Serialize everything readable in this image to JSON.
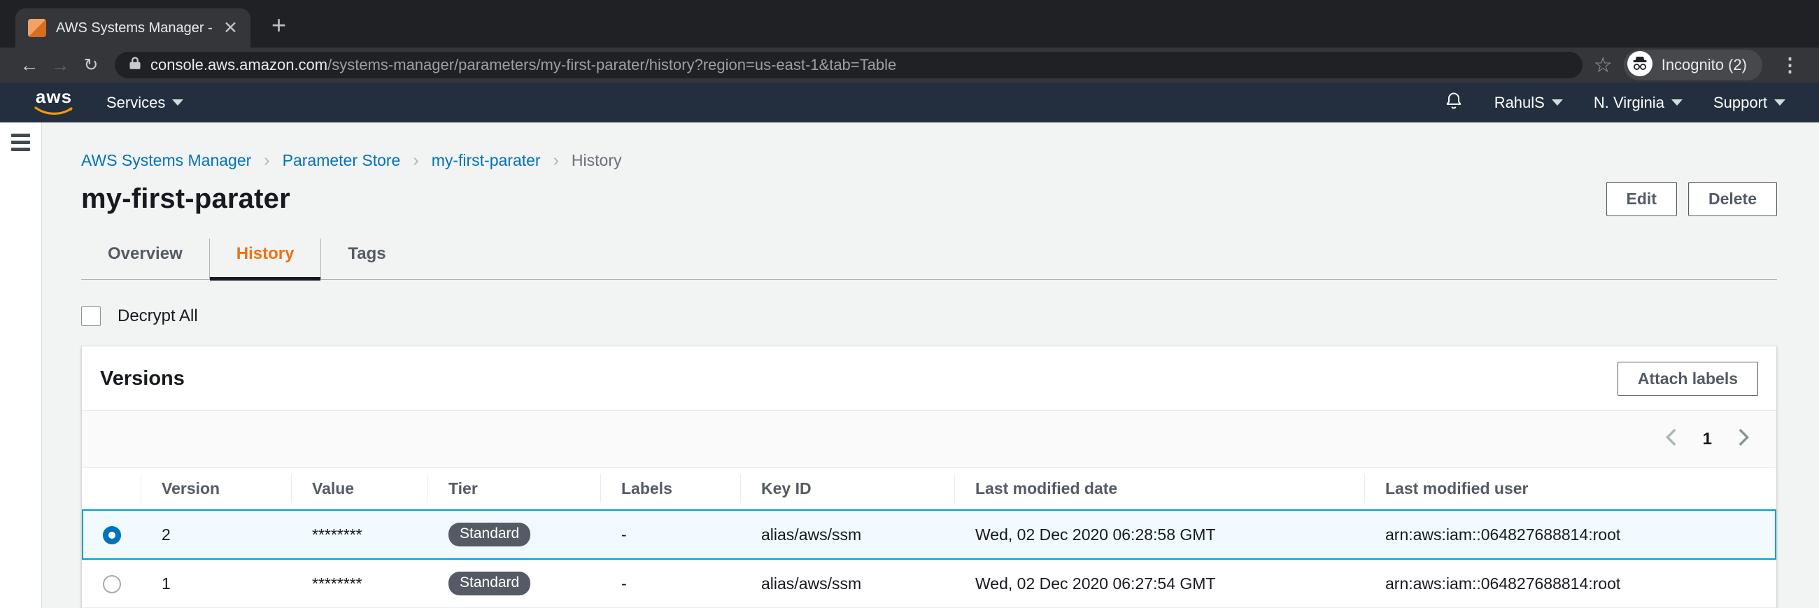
{
  "browser": {
    "tab_title": "AWS Systems Manager - Param",
    "url_domain": "console.aws.amazon.com",
    "url_path": "/systems-manager/parameters/my-first-parater/history?region=us-east-1&tab=Table",
    "incognito_label": "Incognito (2)"
  },
  "nav": {
    "logo_text": "aws",
    "services_label": "Services",
    "user_label": "RahulS",
    "region_label": "N. Virginia",
    "support_label": "Support"
  },
  "breadcrumb": {
    "items": [
      {
        "label": "AWS Systems Manager"
      },
      {
        "label": "Parameter Store"
      },
      {
        "label": "my-first-parater"
      },
      {
        "label": "History"
      }
    ]
  },
  "page": {
    "title": "my-first-parater",
    "edit_label": "Edit",
    "delete_label": "Delete"
  },
  "tabs": [
    {
      "label": "Overview",
      "active": false
    },
    {
      "label": "History",
      "active": true
    },
    {
      "label": "Tags",
      "active": false
    }
  ],
  "filters": {
    "decrypt_all_label": "Decrypt All"
  },
  "versions_panel": {
    "title": "Versions",
    "attach_labels_label": "Attach labels",
    "pagination": {
      "current_page": "1"
    },
    "table": {
      "columns": [
        "Version",
        "Value",
        "Tier",
        "Labels",
        "Key ID",
        "Last modified date",
        "Last modified user"
      ],
      "rows": [
        {
          "selected": true,
          "version": "2",
          "value": "********",
          "tier": "Standard",
          "labels": "-",
          "key_id": "alias/aws/ssm",
          "last_modified_date": "Wed, 02 Dec 2020 06:28:58 GMT",
          "last_modified_user": "arn:aws:iam::064827688814:root"
        },
        {
          "selected": false,
          "version": "1",
          "value": "********",
          "tier": "Standard",
          "labels": "-",
          "key_id": "alias/aws/ssm",
          "last_modified_date": "Wed, 02 Dec 2020 06:27:54 GMT",
          "last_modified_user": "arn:aws:iam::064827688814:root"
        }
      ]
    }
  },
  "colors": {
    "aws_orange_accent": "#ec7211",
    "aws_smile_orange": "#ff9900",
    "link_blue": "#0073bb",
    "selected_row_border": "#00a1c9",
    "selected_row_bg": "#f1faff",
    "aws_nav_bg": "#232f3e",
    "badge_bg": "#545b64",
    "chrome_dark_bg": "#202124",
    "chrome_toolbar_bg": "#35363a",
    "content_bg": "#f2f3f3"
  }
}
